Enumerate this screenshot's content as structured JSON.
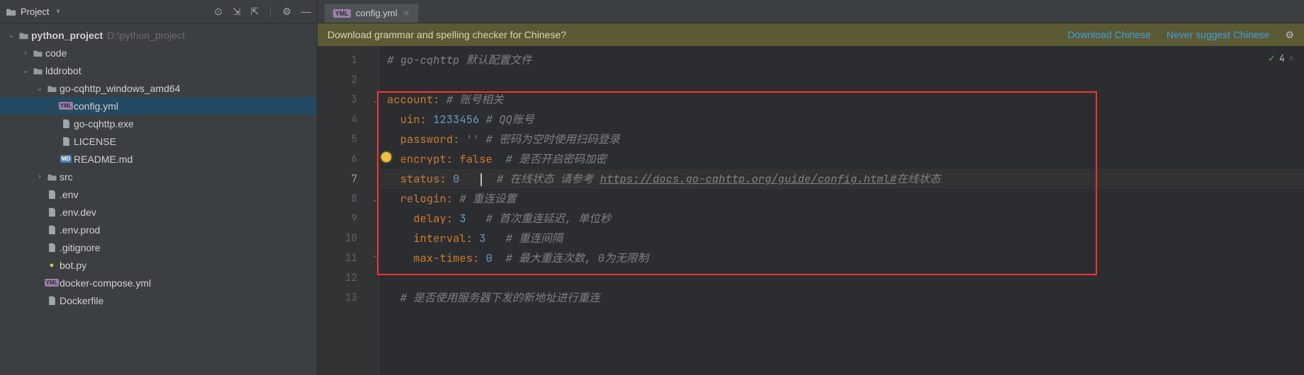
{
  "sidebar": {
    "title": "Project",
    "root": {
      "label": "python_project",
      "path": "D:\\python_project"
    },
    "items": [
      {
        "label": "code",
        "indent": 1,
        "chev": "›",
        "icon": "dir"
      },
      {
        "label": "lddrobot",
        "indent": 1,
        "chev": "⌄",
        "icon": "dir"
      },
      {
        "label": "go-cqhttp_windows_amd64",
        "indent": 2,
        "chev": "⌄",
        "icon": "dir"
      },
      {
        "label": "config.yml",
        "indent": 3,
        "chev": "",
        "icon": "yml",
        "selected": true
      },
      {
        "label": "go-cqhttp.exe",
        "indent": 3,
        "chev": "",
        "icon": "file"
      },
      {
        "label": "LICENSE",
        "indent": 3,
        "chev": "",
        "icon": "file"
      },
      {
        "label": "README.md",
        "indent": 3,
        "chev": "",
        "icon": "md"
      },
      {
        "label": "src",
        "indent": 2,
        "chev": "›",
        "icon": "dir"
      },
      {
        "label": ".env",
        "indent": 2,
        "chev": "",
        "icon": "file"
      },
      {
        "label": ".env.dev",
        "indent": 2,
        "chev": "",
        "icon": "file"
      },
      {
        "label": ".env.prod",
        "indent": 2,
        "chev": "",
        "icon": "file"
      },
      {
        "label": ".gitignore",
        "indent": 2,
        "chev": "",
        "icon": "file"
      },
      {
        "label": "bot.py",
        "indent": 2,
        "chev": "",
        "icon": "py"
      },
      {
        "label": "docker-compose.yml",
        "indent": 2,
        "chev": "",
        "icon": "yml"
      },
      {
        "label": "Dockerfile",
        "indent": 2,
        "chev": "",
        "icon": "file"
      }
    ]
  },
  "tab": {
    "label": "config.yml",
    "badge": "YML"
  },
  "banner": {
    "message": "Download grammar and spelling checker for Chinese?",
    "download": "Download Chinese",
    "never": "Never suggest Chinese"
  },
  "inspection_count": "4",
  "code": {
    "l1_comment": "# go-cqhttp 默认配置文件",
    "l3_key": "account",
    "l3_comment": "# 账号相关",
    "l4_key": "uin",
    "l4_val": "1233456",
    "l4_comment": "# QQ账号",
    "l5_key": "password",
    "l5_val": "''",
    "l5_comment": "# 密码为空时使用扫码登录",
    "l6_key": "encrypt",
    "l6_val": "false",
    "l6_comment": "# 是否开启密码加密",
    "l7_key": "status",
    "l7_val": "0",
    "l7_comment_pre": "# 在线状态 请参考 ",
    "l7_link": "https://docs.go-cqhttp.org/guide/config.html#",
    "l7_comment_post": "在线状态",
    "l8_key": "relogin",
    "l8_comment": "# 重连设置",
    "l9_key": "delay",
    "l9_val": "3",
    "l9_comment": "# 首次重连延迟, 单位秒",
    "l10_key": "interval",
    "l10_val": "3",
    "l10_comment": "# 重连间隔",
    "l11_key": "max-times",
    "l11_val": "0",
    "l11_comment": "# 最大重连次数, 0为无限制",
    "l13_comment": "# 是否使用服务器下发的新地址进行重连"
  }
}
